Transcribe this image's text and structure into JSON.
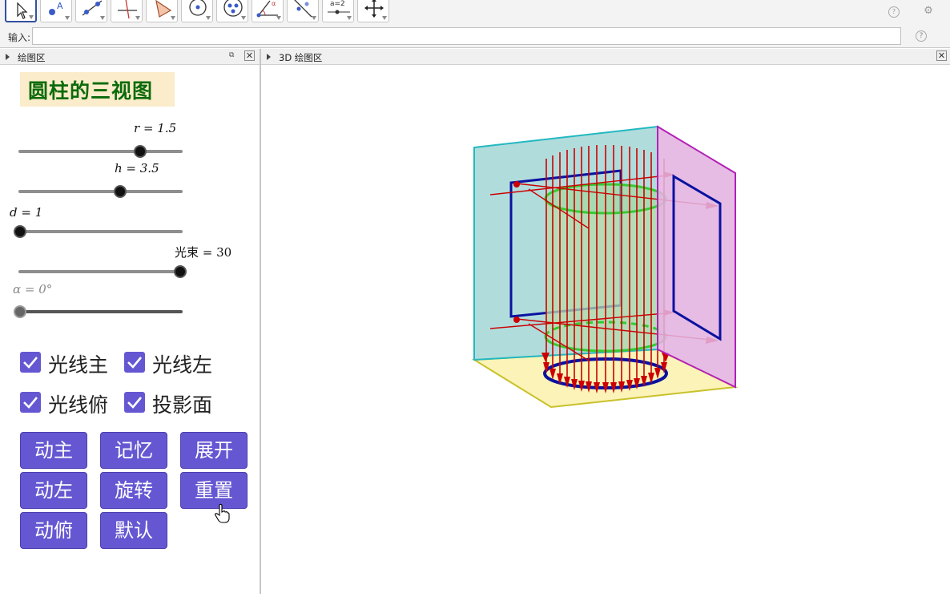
{
  "toolbar": {
    "tools": [
      {
        "name": "move-tool",
        "selected": true
      },
      {
        "name": "point-tool"
      },
      {
        "name": "line-tool"
      },
      {
        "name": "perpendicular-tool"
      },
      {
        "name": "polygon-tool"
      },
      {
        "name": "circle-tool"
      },
      {
        "name": "conic-tool"
      },
      {
        "name": "angle-tool"
      },
      {
        "name": "reflect-tool"
      },
      {
        "name": "slider-tool",
        "label": "a=2"
      },
      {
        "name": "move-graphics-tool"
      }
    ],
    "help_icon": "help-icon",
    "settings_icon": "gear-icon"
  },
  "input_bar": {
    "label": "输入:",
    "value": "",
    "help_icon": "help-icon"
  },
  "left_panel": {
    "header": "绘图区",
    "title": "圆柱的三视图",
    "sliders": [
      {
        "label": "r = 1.5",
        "value": 1.5,
        "fraction": 0.74
      },
      {
        "label": "h = 3.5",
        "value": 3.5,
        "fraction": 0.62
      },
      {
        "label": "d = 1",
        "value": 1,
        "fraction": 0.0
      },
      {
        "label": "光束 = 30",
        "value": 30,
        "fraction": 1.0
      },
      {
        "label": "α = 0°",
        "value": 0,
        "fraction": 0.0
      }
    ],
    "checkboxes": [
      {
        "label": "光线主",
        "checked": true
      },
      {
        "label": "光线左",
        "checked": true
      },
      {
        "label": "光线俯",
        "checked": true
      },
      {
        "label": "投影面",
        "checked": true
      }
    ],
    "buttons": [
      "动主",
      "记忆",
      "展开",
      "动左",
      "旋转",
      "重置",
      "动俯",
      "默认"
    ]
  },
  "view3d": {
    "header": "3D 绘图区",
    "colors": {
      "back_plane": "#a9d8d8",
      "side_plane": "#e3b3e0",
      "floor_plane": "#fbf3b8",
      "cylinder": "#b8dcaa",
      "rays": "#cc0000",
      "projection": "#0a12a0",
      "ellipse": "#33cc33"
    }
  },
  "accent_color": "#6557d2"
}
